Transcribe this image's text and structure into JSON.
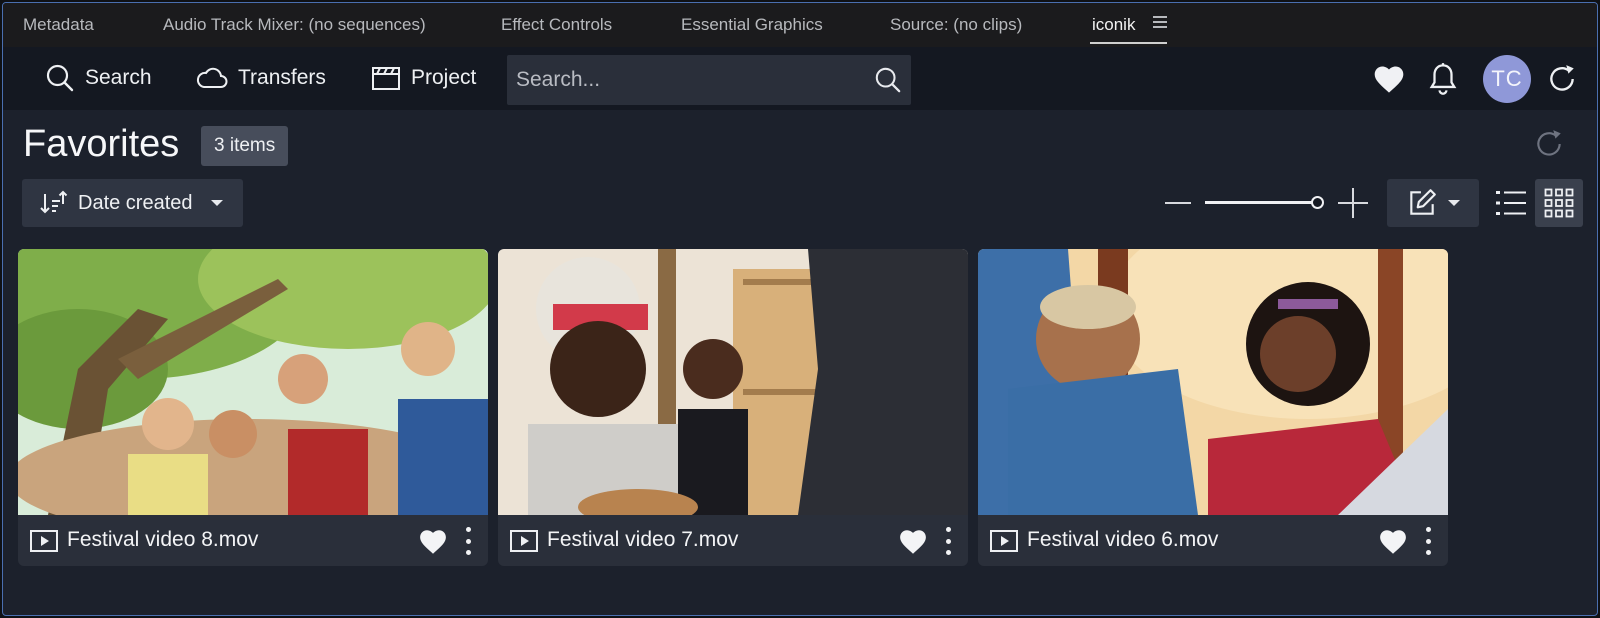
{
  "panel_tabs": [
    {
      "label": "Metadata"
    },
    {
      "label": "Audio Track Mixer: (no sequences)"
    },
    {
      "label": "Effect Controls"
    },
    {
      "label": "Essential Graphics"
    },
    {
      "label": "Source: (no clips)"
    },
    {
      "label": "iconik",
      "active": true
    }
  ],
  "toolbar": {
    "search_label": "Search",
    "transfers_label": "Transfers",
    "project_label": "Project",
    "search_placeholder": "Search...",
    "avatar_initials": "TC",
    "icons": [
      "magnifier-icon",
      "cloud-icon",
      "clapper-icon",
      "heart-icon",
      "bell-icon",
      "refresh-icon"
    ]
  },
  "header": {
    "title": "Favorites",
    "count": "3 items"
  },
  "controls": {
    "sort_label": "Date created",
    "zoom_level": 1.0,
    "view_mode": "grid"
  },
  "assets": [
    {
      "title": "Festival video 8.mov",
      "favorite": true
    },
    {
      "title": "Festival video 7.mov",
      "favorite": true
    },
    {
      "title": "Festival video 6.mov",
      "favorite": true
    }
  ],
  "colors": {
    "accent_border": "#4a6fb0",
    "avatar": "#8f98d8",
    "panel_bg": "#1c212c",
    "card_bg": "#2a2f3a"
  }
}
